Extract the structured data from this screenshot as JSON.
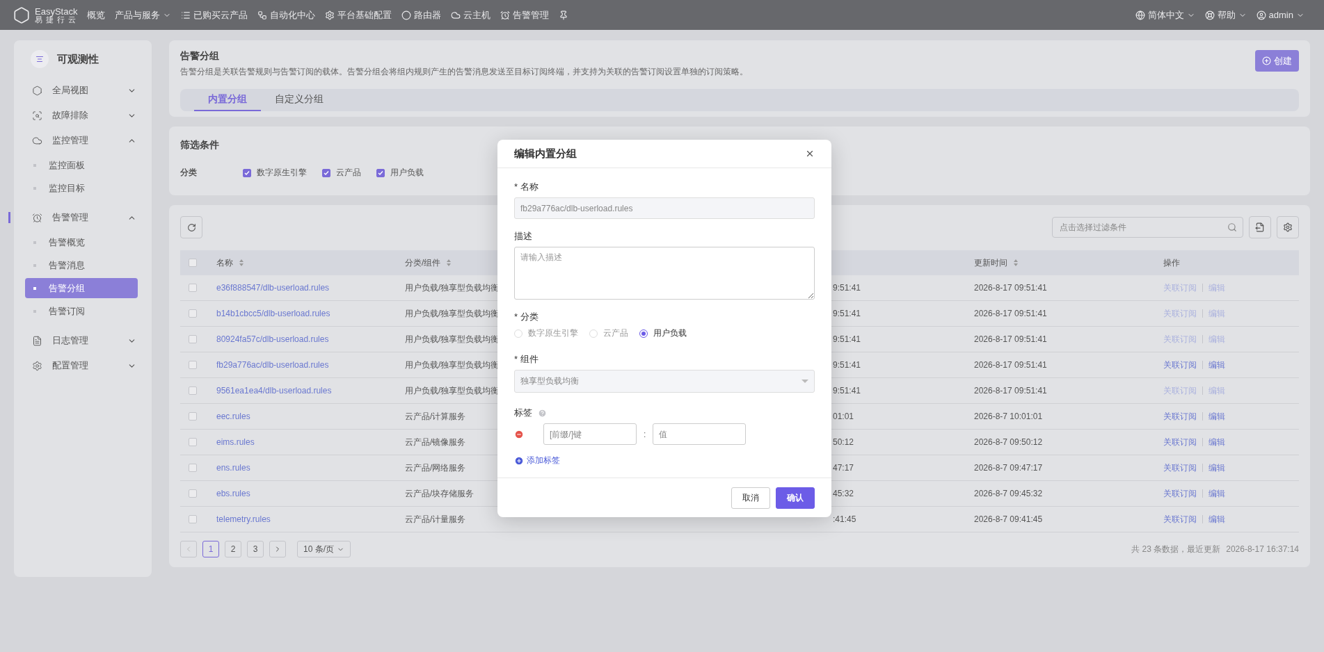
{
  "topbar": {
    "logo": {
      "name": "EasyStack",
      "subtitle": "易 捷 行 云"
    },
    "nav": [
      {
        "label": "概览",
        "dropdown": false
      },
      {
        "label": "产品与服务",
        "dropdown": true
      },
      {
        "label": "已购买云产品",
        "dropdown": false
      },
      {
        "label": "自动化中心",
        "dropdown": false
      },
      {
        "label": "平台基础配置",
        "dropdown": false
      },
      {
        "label": "路由器",
        "dropdown": false
      },
      {
        "label": "云主机",
        "dropdown": false
      },
      {
        "label": "告警管理",
        "dropdown": false
      }
    ],
    "right": [
      {
        "label": "简体中文"
      },
      {
        "label": "帮助"
      },
      {
        "label": "admin"
      }
    ]
  },
  "sidebar": {
    "title": "可观测性",
    "items": [
      {
        "label": "全局视图",
        "expanded": false
      },
      {
        "label": "故障排除",
        "expanded": false
      },
      {
        "label": "监控管理",
        "expanded": true,
        "children": [
          {
            "label": "监控面板",
            "selected": false
          },
          {
            "label": "监控目标",
            "selected": false
          }
        ]
      },
      {
        "label": "告警管理",
        "expanded": true,
        "children": [
          {
            "label": "告警概览",
            "selected": false
          },
          {
            "label": "告警消息",
            "selected": false
          },
          {
            "label": "告警分组",
            "selected": true
          },
          {
            "label": "告警订阅",
            "selected": false
          }
        ]
      },
      {
        "label": "日志管理",
        "expanded": false
      },
      {
        "label": "配置管理",
        "expanded": false
      }
    ]
  },
  "header": {
    "title": "告警分组",
    "description": "告警分组是关联告警规则与告警订阅的载体。告警分组会将组内规则产生的告警消息发送至目标订阅终端，并支持为关联的告警订阅设置单独的订阅策略。",
    "create_button": "创建",
    "tabs": [
      {
        "label": "内置分组",
        "selected": true
      },
      {
        "label": "自定义分组",
        "selected": false
      }
    ]
  },
  "filter": {
    "title": "筛选条件",
    "label": "分类",
    "options": [
      {
        "label": "数字原生引擎",
        "checked": true
      },
      {
        "label": "云产品",
        "checked": true
      },
      {
        "label": "用户负载",
        "checked": true
      }
    ]
  },
  "table": {
    "search": {
      "placeholder": "点击选择过滤条件"
    },
    "select_all_checked": false,
    "columns": [
      {
        "label": "名称",
        "sortable": true
      },
      {
        "label": "分类/组件",
        "sortable": true
      },
      {
        "label": "更新时间",
        "sortable": true
      },
      {
        "label": "操作",
        "sortable": false
      }
    ],
    "rows": [
      {
        "checked": false,
        "name": "e36f888547/dlb-userload.rules",
        "category": "用户负载/独享型负载均衡",
        "column_4": "9:51:41",
        "updated": "2026-8-17 09:51:41",
        "actions": [
          "关联订阅",
          "编辑"
        ],
        "actions_disabled": true
      },
      {
        "checked": false,
        "name": "b14b1cbcc5/dlb-userload.rules",
        "category": "用户负载/独享型负载均衡",
        "column_4": "9:51:41",
        "updated": "2026-8-17 09:51:41",
        "actions": [
          "关联订阅",
          "编辑"
        ],
        "actions_disabled": true
      },
      {
        "checked": false,
        "name": "80924fa57c/dlb-userload.rules",
        "category": "用户负载/独享型负载均衡",
        "column_4": "9:51:41",
        "updated": "2026-8-17 09:51:41",
        "actions": [
          "关联订阅",
          "编辑"
        ],
        "actions_disabled": true
      },
      {
        "checked": false,
        "name": "fb29a776ac/dlb-userload.rules",
        "category": "用户负载/独享型负载均衡",
        "column_4": "9:51:41",
        "updated": "2026-8-17 09:51:41",
        "actions": [
          "关联订阅",
          "编辑"
        ],
        "actions_disabled": false
      },
      {
        "checked": false,
        "name": "9561ea1ea4/dlb-userload.rules",
        "category": "用户负载/独享型负载均衡",
        "column_4": "9:51:41",
        "updated": "2026-8-17 09:51:41",
        "actions": [
          "关联订阅",
          "编辑"
        ],
        "actions_disabled": true
      },
      {
        "checked": false,
        "name": "eec.rules",
        "category": "云产品/计算服务",
        "column_4": "01:01",
        "updated": "2026-8-7 10:01:01",
        "actions": [
          "关联订阅",
          "编辑"
        ],
        "actions_disabled": false
      },
      {
        "checked": false,
        "name": "eims.rules",
        "category": "云产品/镜像服务",
        "column_4": "50:12",
        "updated": "2026-8-7 09:50:12",
        "actions": [
          "关联订阅",
          "编辑"
        ],
        "actions_disabled": false
      },
      {
        "checked": false,
        "name": "ens.rules",
        "category": "云产品/网络服务",
        "column_4": "47:17",
        "updated": "2026-8-7 09:47:17",
        "actions": [
          "关联订阅",
          "编辑"
        ],
        "actions_disabled": false
      },
      {
        "checked": false,
        "name": "ebs.rules",
        "category": "云产品/块存储服务",
        "column_4": "45:32",
        "updated": "2026-8-7 09:45:32",
        "actions": [
          "关联订阅",
          "编辑"
        ],
        "actions_disabled": false
      },
      {
        "checked": false,
        "name": "telemetry.rules",
        "category": "云产品/计量服务",
        "column_4": ":41:45",
        "updated": "2026-8-7 09:41:45",
        "actions": [
          "关联订阅",
          "编辑"
        ],
        "actions_disabled": false
      }
    ],
    "pagination": {
      "pages": [
        {
          "label": "1",
          "selected": true
        },
        {
          "label": "2",
          "selected": false
        },
        {
          "label": "3",
          "selected": false
        }
      ],
      "page_size": "10 条/页",
      "summary": "共 23 条数据，最近更新",
      "updated": "2026-8-17 16:37:14"
    }
  },
  "dialog": {
    "title": "编辑内置分组",
    "name": {
      "label": "* 名称",
      "value": "fb29a776ac/dlb-userload.rules"
    },
    "description": {
      "label": "描述",
      "placeholder": "请输入描述"
    },
    "category": {
      "label": "* 分类",
      "options": [
        {
          "label": "数字原生引擎",
          "selected": false
        },
        {
          "label": "云产品",
          "selected": false
        },
        {
          "label": "用户负载",
          "selected": true
        }
      ]
    },
    "component": {
      "label": "* 组件",
      "value": "独享型负载均衡"
    },
    "tags": {
      "label": "标签",
      "rows": [
        {
          "key_placeholder": "[前缀/]键",
          "separator": ":",
          "value_placeholder": "值"
        }
      ],
      "add_label": "添加标签"
    },
    "buttons": {
      "cancel": "取消",
      "confirm": "确认"
    }
  }
}
